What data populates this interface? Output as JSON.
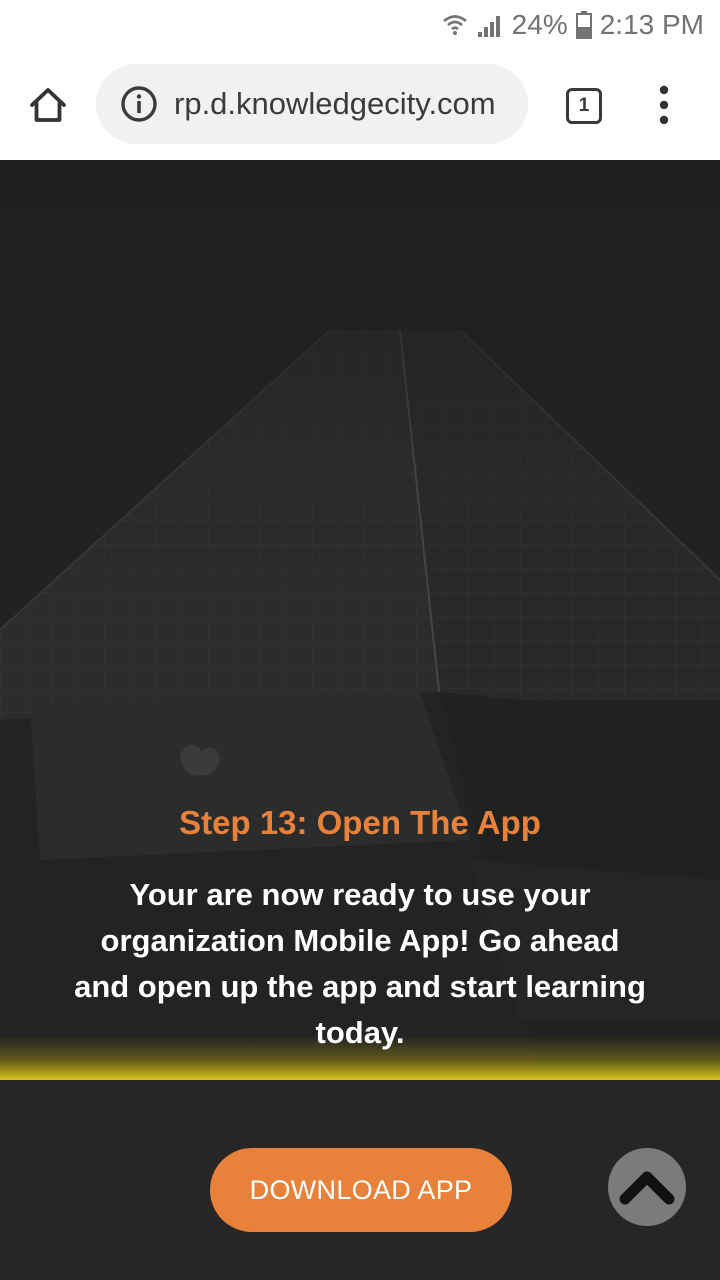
{
  "status_bar": {
    "battery": "24%",
    "time": "2:13 PM",
    "icons": [
      "wifi-icon",
      "signal-icon",
      "battery-icon"
    ]
  },
  "browser": {
    "url": "rp.d.knowledgecity.com",
    "tab_count": "1",
    "icons": [
      "home-icon",
      "info-icon",
      "overflow-menu-icon"
    ]
  },
  "content": {
    "step_title": "Step 13: Open The App",
    "step_body": "Your are now ready to use your organization Mobile App! Go ahead and open up the app and start learning today.",
    "download_label": "DOWNLOAD APP"
  },
  "colors": {
    "accent": "#e8823a",
    "glow": "#d7c51b",
    "background": "#262626"
  }
}
